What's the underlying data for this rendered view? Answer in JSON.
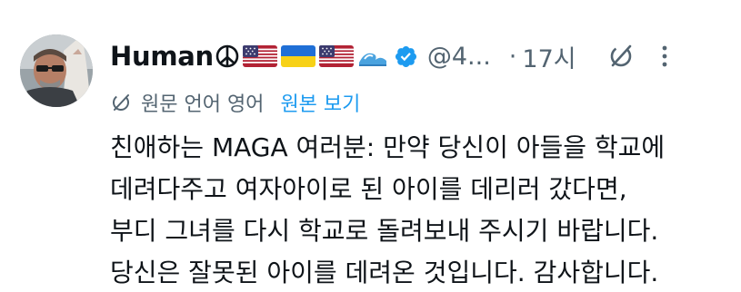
{
  "tweet": {
    "author": {
      "display_name": "Human",
      "name_emojis": [
        "peace-symbol",
        "us-flag",
        "ukraine-flag",
        "us-flag",
        "wave"
      ],
      "handle": "@4...",
      "verified": true
    },
    "timestamp": {
      "separator": "·",
      "text": "17시"
    },
    "translation": {
      "label": "원문 언어 영어",
      "show_original": "원본 보기"
    },
    "body_lines": [
      "친애하는 MAGA 여러분: 만약 당신이 아들을 학교에",
      "데려다주고 여자아이로 된 아이를 데리러 갔다면,",
      "부디 그녀를 다시 학교로 돌려보내 주시기 바랍니다.",
      "당신은 잘못된 아이를 데려온 것입니다. 감사합니다."
    ]
  },
  "icons": {
    "verified": "verified-badge-icon",
    "grok": "grok-icon",
    "more": "more-dots-icon",
    "translate": "translate-icon"
  },
  "colors": {
    "text": "#0f1419",
    "secondary": "#536471",
    "link": "#1d9bf0",
    "verified": "#1d9bf0"
  }
}
